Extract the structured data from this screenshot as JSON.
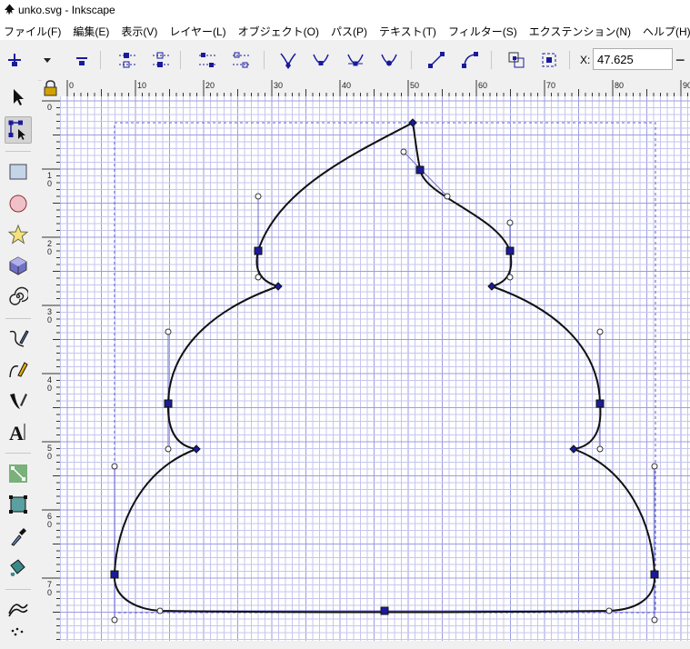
{
  "window": {
    "title": "unko.svg - Inkscape"
  },
  "menu": [
    "ファイル(F)",
    "編集(E)",
    "表示(V)",
    "レイヤー(L)",
    "オブジェクト(O)",
    "パス(P)",
    "テキスト(T)",
    "フィルター(S)",
    "エクステンション(N)",
    "ヘルプ(H)"
  ],
  "toolbar": {
    "x_label": "X:",
    "x_value": "47.625",
    "decrement_symbol": "−",
    "buttons": [
      "insert-node-icon",
      "insert-node-menu-icon",
      "delete-node-icon",
      "join-nodes-icon",
      "break-path-icon",
      "join-segment-icon",
      "delete-segment-icon",
      "make-cusp-icon",
      "make-smooth-icon",
      "make-symmetric-icon",
      "make-auto-smooth-icon",
      "segment-to-line-icon",
      "segment-to-curve-icon",
      "object-to-path-icon",
      "stroke-to-path-icon"
    ]
  },
  "tools": [
    "selector-tool-icon",
    "node-tool-icon",
    "rectangle-tool-icon",
    "ellipse-tool-icon",
    "star-tool-icon",
    "box-3d-tool-icon",
    "spiral-tool-icon",
    "pencil-tool-icon",
    "pen-tool-icon",
    "calligraphy-tool-icon",
    "text-tool-icon",
    "connector-tool-icon",
    "mesh-tool-icon",
    "dropper-tool-icon",
    "paint-bucket-tool-icon",
    "tweak-tool-icon",
    "spray-tool-icon"
  ],
  "ruler": {
    "horizontal_labels": [
      "0",
      "10",
      "20",
      "30",
      "40",
      "50",
      "60",
      "70",
      "80",
      "90"
    ],
    "vertical_labels": [
      "0",
      "1\n0",
      "2\n0",
      "3\n0",
      "4\n0",
      "5\n0",
      "6\n0",
      "7\n0"
    ]
  },
  "colors": {
    "grid": "#c6c6ee",
    "grid_major": "#9c9ce0",
    "path": "#000000",
    "handle": "#1a1a9c",
    "bbox": "#5c5cd6"
  }
}
